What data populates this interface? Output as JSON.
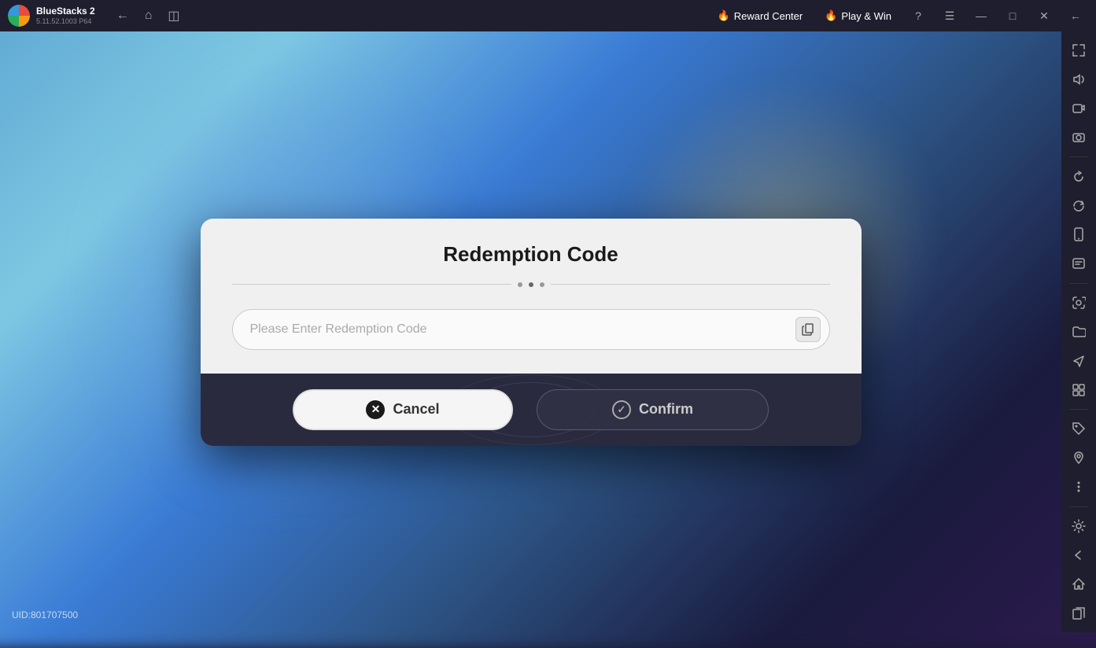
{
  "app": {
    "name": "BlueStacks 2",
    "version": "5.11.52.1003  P64"
  },
  "titlebar": {
    "reward_center_label": "Reward Center",
    "play_win_label": "Play & Win",
    "reward_icon": "🔥",
    "play_icon": "🔥"
  },
  "controls": {
    "help": "?",
    "menu": "☰",
    "minimize": "—",
    "restore": "⬜",
    "close": "✕",
    "back": "←"
  },
  "sidebar": {
    "icons": [
      {
        "name": "fullscreen-icon",
        "glyph": "⛶"
      },
      {
        "name": "volume-icon",
        "glyph": "🔊"
      },
      {
        "name": "screen-icon",
        "glyph": "▶"
      },
      {
        "name": "record-icon",
        "glyph": "🎬"
      },
      {
        "name": "rotate-icon",
        "glyph": "↺"
      },
      {
        "name": "refresh-icon",
        "glyph": "⟳"
      },
      {
        "name": "device-icon",
        "glyph": "📱"
      },
      {
        "name": "news-icon",
        "glyph": "📰"
      },
      {
        "name": "screenshot-icon",
        "glyph": "📷"
      },
      {
        "name": "folder-icon",
        "glyph": "📁"
      },
      {
        "name": "plane-icon",
        "glyph": "✈"
      },
      {
        "name": "compress-icon",
        "glyph": "⊞"
      },
      {
        "name": "tag-icon",
        "glyph": "🏷"
      },
      {
        "name": "location-icon",
        "glyph": "📍"
      },
      {
        "name": "more-icon",
        "glyph": "•••"
      },
      {
        "name": "settings-icon",
        "glyph": "⚙"
      },
      {
        "name": "back-icon",
        "glyph": "←"
      },
      {
        "name": "home-icon",
        "glyph": "⌂"
      },
      {
        "name": "pages-icon",
        "glyph": "⧉"
      }
    ]
  },
  "modal": {
    "title": "Redemption Code",
    "input_placeholder": "Please Enter Redemption Code",
    "cancel_label": "Cancel",
    "confirm_label": "Confirm",
    "divider_dots": 3
  },
  "footer": {
    "uid": "UID:801707500"
  }
}
